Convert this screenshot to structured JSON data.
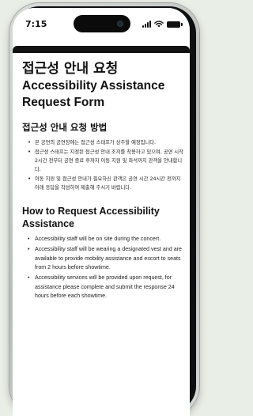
{
  "status_bar": {
    "time": "7:15",
    "icons": [
      "signal-icon",
      "wifi-icon",
      "battery-icon"
    ]
  },
  "page": {
    "title_ko": "접근성 안내 요청",
    "title_en": "Accessibility Assistance Request Form",
    "section_ko": {
      "heading": "접근성 안내 요청 방법",
      "items": [
        "본 공연의 공연장에는 접근성 스태프가 상주할 예정입니다.",
        "접근성 스태프는 지정된 접근성 안내 조끼를 착용하고 있으며, 공연 시작 2시간 전부터 공연 종료 후까지 이동 지원 및 좌석까지 관객을 안내합니다.",
        "이동 지원 및 접근성 안내가 필요하신 관객은 공연 시간 24시간 전까지 아래 응답을 작성하여 제출해 주시기 바랍니다."
      ]
    },
    "section_en": {
      "heading": "How to Request Accessibility Assistance",
      "items": [
        "Accessibility staff will be on site during the concert.",
        "Accessibility staff will be wearing a designated vest and are available to provide mobility assistance and escort to seats from 2 hours before showtime.",
        "Accessibility services will be provided upon request, for assistance please complete and submit the response 24 hours before each showtime."
      ]
    }
  }
}
